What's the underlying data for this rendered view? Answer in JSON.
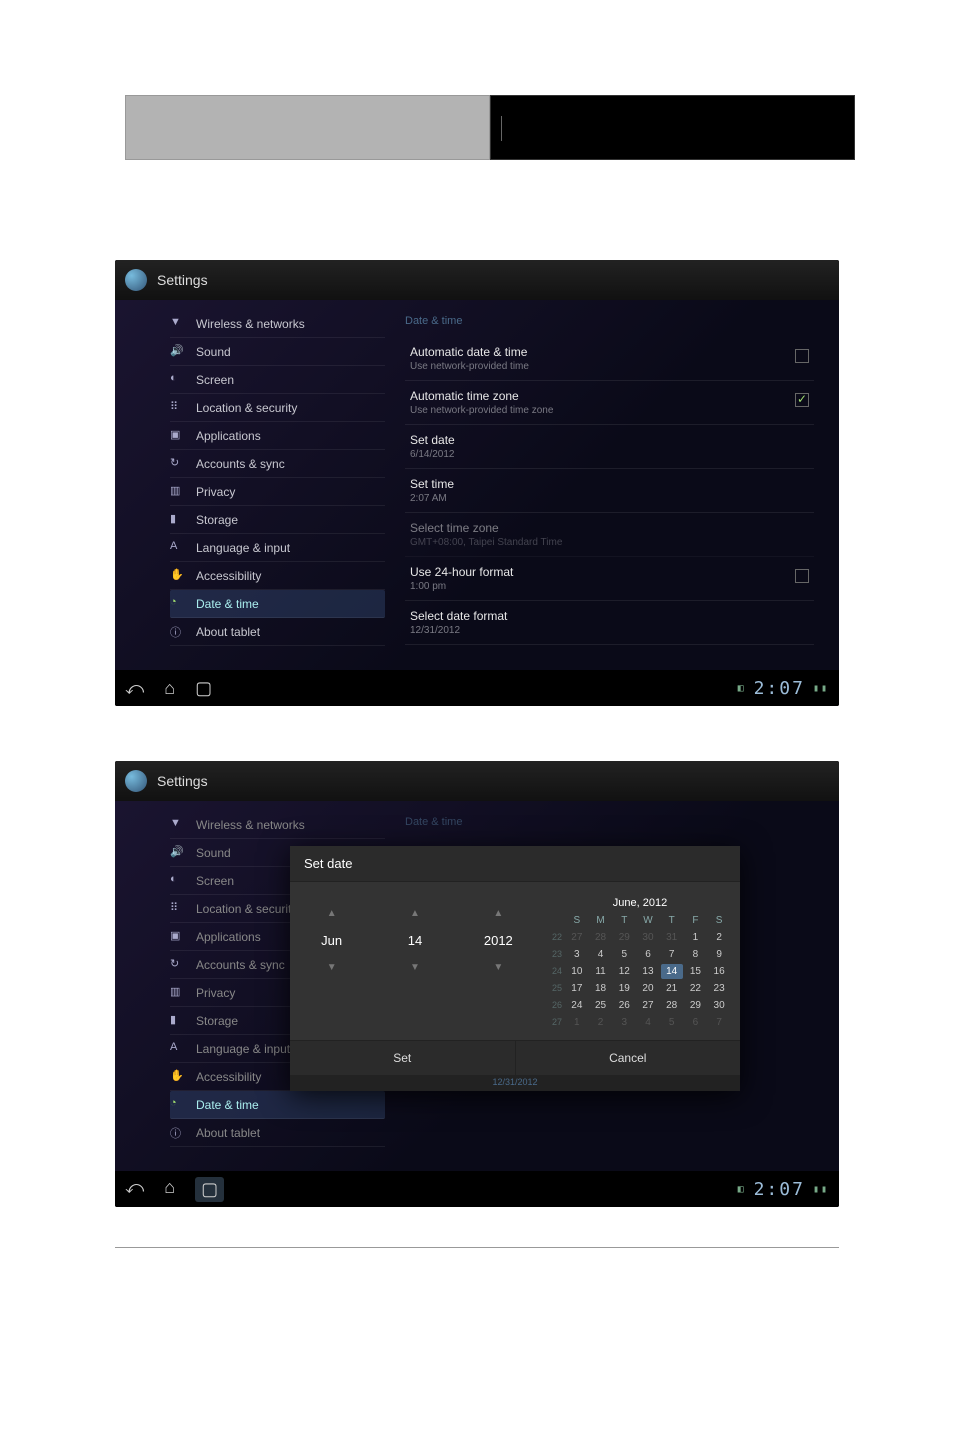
{
  "header": {
    "title": "Settings",
    "section": "Date & time"
  },
  "sidebar": [
    {
      "label": "Wireless & networks",
      "icon": "wifi"
    },
    {
      "label": "Sound",
      "icon": "sound"
    },
    {
      "label": "Screen",
      "icon": "screen"
    },
    {
      "label": "Location & security",
      "icon": "location"
    },
    {
      "label": "Applications",
      "icon": "apps"
    },
    {
      "label": "Accounts & sync",
      "icon": "sync"
    },
    {
      "label": "Privacy",
      "icon": "privacy"
    },
    {
      "label": "Storage",
      "icon": "storage"
    },
    {
      "label": "Language & input",
      "icon": "lang"
    },
    {
      "label": "Accessibility",
      "icon": "access"
    },
    {
      "label": "Date & time",
      "icon": "clock",
      "selected": true
    },
    {
      "label": "About tablet",
      "icon": "about"
    }
  ],
  "settings": [
    {
      "label": "Automatic date & time",
      "sub": "Use network-provided time",
      "check": false
    },
    {
      "label": "Automatic time zone",
      "sub": "Use network-provided time zone",
      "check": true
    },
    {
      "label": "Set date",
      "sub": "6/14/2012"
    },
    {
      "label": "Set time",
      "sub": "2:07 AM"
    },
    {
      "label": "Select time zone",
      "sub": "GMT+08:00, Taipei Standard Time",
      "disabled": true
    },
    {
      "label": "Use 24-hour format",
      "sub": "1:00 pm",
      "check": false
    },
    {
      "label": "Select date format",
      "sub": "12/31/2012"
    }
  ],
  "statusbar": {
    "time": "2:07"
  },
  "dialog": {
    "title": "Set date",
    "month": "Jun",
    "day": "14",
    "year": "2012",
    "cal_title": "June, 2012",
    "dow": [
      "S",
      "M",
      "T",
      "W",
      "T",
      "F",
      "S"
    ],
    "weeks": [
      {
        "wk": "22",
        "days": [
          "27",
          "28",
          "29",
          "30",
          "31",
          "1",
          "2"
        ],
        "out": [
          0,
          1,
          2,
          3,
          4
        ]
      },
      {
        "wk": "23",
        "days": [
          "3",
          "4",
          "5",
          "6",
          "7",
          "8",
          "9"
        ]
      },
      {
        "wk": "24",
        "days": [
          "10",
          "11",
          "12",
          "13",
          "14",
          "15",
          "16"
        ],
        "sel": 4
      },
      {
        "wk": "25",
        "days": [
          "17",
          "18",
          "19",
          "20",
          "21",
          "22",
          "23"
        ]
      },
      {
        "wk": "26",
        "days": [
          "24",
          "25",
          "26",
          "27",
          "28",
          "29",
          "30"
        ]
      },
      {
        "wk": "27",
        "days": [
          "1",
          "2",
          "3",
          "4",
          "5",
          "6",
          "7"
        ],
        "out": [
          0,
          1,
          2,
          3,
          4,
          5,
          6
        ]
      }
    ],
    "set": "Set",
    "cancel": "Cancel",
    "below_date": "12/31/2012"
  }
}
